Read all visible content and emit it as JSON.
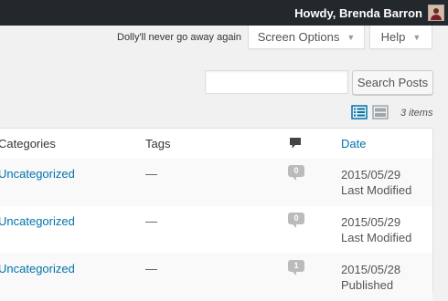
{
  "admin_bar": {
    "greeting": "Howdy, Brenda Barron"
  },
  "dolly_text": "Dolly'll never go away again",
  "tabs": {
    "screen_options": "Screen Options",
    "help": "Help"
  },
  "search": {
    "value": "",
    "button_label": "Search Posts"
  },
  "items_count": "3 items",
  "table": {
    "headers": {
      "categories": "Categories",
      "tags": "Tags",
      "date": "Date"
    },
    "rows": [
      {
        "category": "Uncategorized",
        "tags": "—",
        "comments": "0",
        "date": "2015/05/29",
        "status": "Last Modified"
      },
      {
        "category": "Uncategorized",
        "tags": "—",
        "comments": "0",
        "date": "2015/05/29",
        "status": "Last Modified"
      },
      {
        "category": "Uncategorized",
        "tags": "—",
        "comments": "1",
        "date": "2015/05/28",
        "status": "Published"
      }
    ]
  },
  "colors": {
    "admin_bar_bg": "#23282d",
    "link": "#0073aa",
    "page_bg": "#f1f1f1",
    "bubble_bg": "#bbbbbb",
    "active_view_icon": "#0073aa",
    "inactive_view_icon": "#a0a5aa"
  },
  "icons": {
    "avatar": "user-avatar",
    "view_list": "list-view-icon",
    "view_excerpt": "excerpt-view-icon",
    "comments_header": "comment-bubble-icon",
    "caret": "caret-down-icon"
  }
}
